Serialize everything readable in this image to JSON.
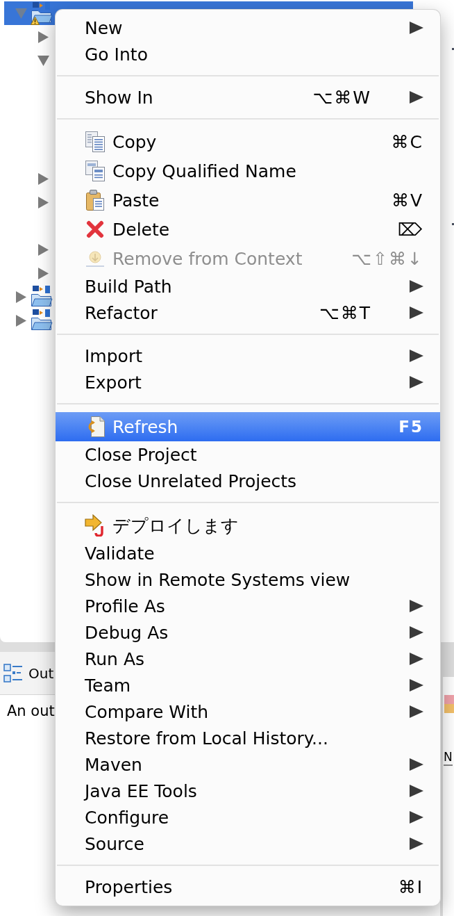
{
  "tree": [
    {
      "kind": "project",
      "expanded": true,
      "selected": true,
      "warning": true,
      "children": [
        {
          "kind": "folder",
          "expanded": false,
          "selected": false
        },
        {
          "kind": "folder",
          "expanded": true,
          "selected": false,
          "children": [
            {
              "selected": false
            },
            {
              "selected": false
            },
            {
              "selected": false
            },
            {
              "selected": false
            }
          ]
        },
        {
          "kind": "folder",
          "expanded": false,
          "selected": false
        },
        {
          "kind": "folder",
          "expanded": false,
          "selected": false
        },
        {
          "kind": "item",
          "selected": false
        },
        {
          "kind": "folder",
          "expanded": false,
          "selected": false
        },
        {
          "kind": "folder",
          "expanded": false,
          "selected": false
        }
      ]
    },
    {
      "kind": "project",
      "expanded": false,
      "selected": false,
      "warning": false
    },
    {
      "kind": "project",
      "expanded": false,
      "selected": false,
      "warning": false
    }
  ],
  "outline": {
    "title": "Out",
    "message": "An out"
  },
  "side_panel": {
    "label": "N"
  },
  "menu": {
    "sections": [
      {
        "items": [
          {
            "label": "New",
            "submenu": true,
            "disabled": false,
            "selected": false
          },
          {
            "label": "Go Into",
            "submenu": false,
            "disabled": false,
            "selected": false
          }
        ]
      },
      {
        "items": [
          {
            "label": "Show In",
            "shortcut": "⌥⌘W",
            "submenu": true,
            "disabled": false,
            "selected": false
          }
        ]
      },
      {
        "items": [
          {
            "label": "Copy",
            "shortcut": "⌘C",
            "submenu": false,
            "disabled": false,
            "selected": false
          },
          {
            "label": "Copy Qualified Name",
            "submenu": false,
            "disabled": false,
            "selected": false
          },
          {
            "label": "Paste",
            "shortcut": "⌘V",
            "submenu": false,
            "disabled": false,
            "selected": false
          },
          {
            "label": "Delete",
            "shortcut": "⌦",
            "submenu": false,
            "disabled": false,
            "selected": false
          },
          {
            "label": "Remove from Context",
            "shortcut": "⌥⇧⌘↓",
            "submenu": false,
            "disabled": true,
            "selected": false
          },
          {
            "label": "Build Path",
            "submenu": true,
            "disabled": false,
            "selected": false
          },
          {
            "label": "Refactor",
            "shortcut": "⌥⌘T",
            "submenu": true,
            "disabled": false,
            "selected": false
          }
        ]
      },
      {
        "items": [
          {
            "label": "Import",
            "submenu": true,
            "disabled": false,
            "selected": false
          },
          {
            "label": "Export",
            "submenu": true,
            "disabled": false,
            "selected": false
          }
        ]
      },
      {
        "items": [
          {
            "label": "Refresh",
            "shortcut": "F5",
            "submenu": false,
            "disabled": false,
            "selected": true
          },
          {
            "label": "Close Project",
            "submenu": false,
            "disabled": false,
            "selected": false
          },
          {
            "label": "Close Unrelated Projects",
            "submenu": false,
            "disabled": false,
            "selected": false
          }
        ]
      },
      {
        "items": [
          {
            "label": "デプロイします",
            "submenu": false,
            "disabled": false,
            "selected": false
          },
          {
            "label": "Validate",
            "submenu": false,
            "disabled": false,
            "selected": false
          },
          {
            "label": "Show in Remote Systems view",
            "submenu": false,
            "disabled": false,
            "selected": false
          },
          {
            "label": "Profile As",
            "submenu": true,
            "disabled": false,
            "selected": false
          },
          {
            "label": "Debug As",
            "submenu": true,
            "disabled": false,
            "selected": false
          },
          {
            "label": "Run As",
            "submenu": true,
            "disabled": false,
            "selected": false
          },
          {
            "label": "Team",
            "submenu": true,
            "disabled": false,
            "selected": false
          },
          {
            "label": "Compare With",
            "submenu": true,
            "disabled": false,
            "selected": false
          },
          {
            "label": "Restore from Local History...",
            "submenu": false,
            "disabled": false,
            "selected": false
          },
          {
            "label": "Maven",
            "submenu": true,
            "disabled": false,
            "selected": false
          },
          {
            "label": "Java EE Tools",
            "submenu": true,
            "disabled": false,
            "selected": false
          },
          {
            "label": "Configure",
            "submenu": true,
            "disabled": false,
            "selected": false
          },
          {
            "label": "Source",
            "submenu": true,
            "disabled": false,
            "selected": false
          }
        ]
      },
      {
        "items": [
          {
            "label": "Properties",
            "shortcut": "⌘I",
            "submenu": false,
            "disabled": false,
            "selected": false
          }
        ]
      }
    ]
  }
}
